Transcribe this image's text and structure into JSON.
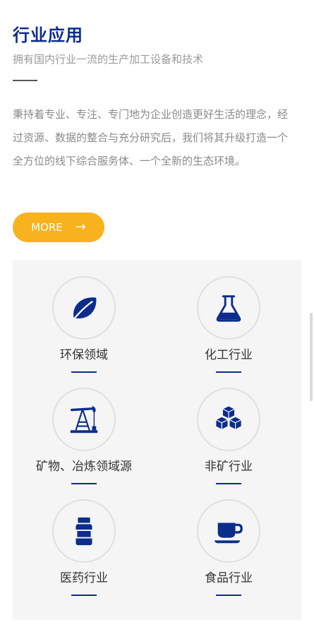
{
  "section": {
    "title": "行业应用",
    "subtitle": "拥有国内行业一流的生产加工设备和技术",
    "description": "秉持着专业、专注、专门地为企业创造更好生活的理念，经过资源、数据的整合与充分研究后，我们将其升级打造一个全方位的线下综合服务体、一个全新的生态环境。",
    "more_button": {
      "label": "MORE",
      "arrow": "→"
    }
  },
  "industries": [
    {
      "label": "环保领域",
      "icon": "leaf-icon"
    },
    {
      "label": "化工行业",
      "icon": "flask-icon"
    },
    {
      "label": "矿物、冶炼领域源",
      "icon": "oil-pump-icon"
    },
    {
      "label": "非矿行业",
      "icon": "cubes-icon"
    },
    {
      "label": "医药行业",
      "icon": "medicine-bottle-icon"
    },
    {
      "label": "食品行业",
      "icon": "coffee-cup-icon"
    }
  ],
  "colors": {
    "title": "#0c2d8c",
    "accent_button": "#f7b21d",
    "icon": "#0c2d8c",
    "panel_background": "#f5f5f5"
  }
}
